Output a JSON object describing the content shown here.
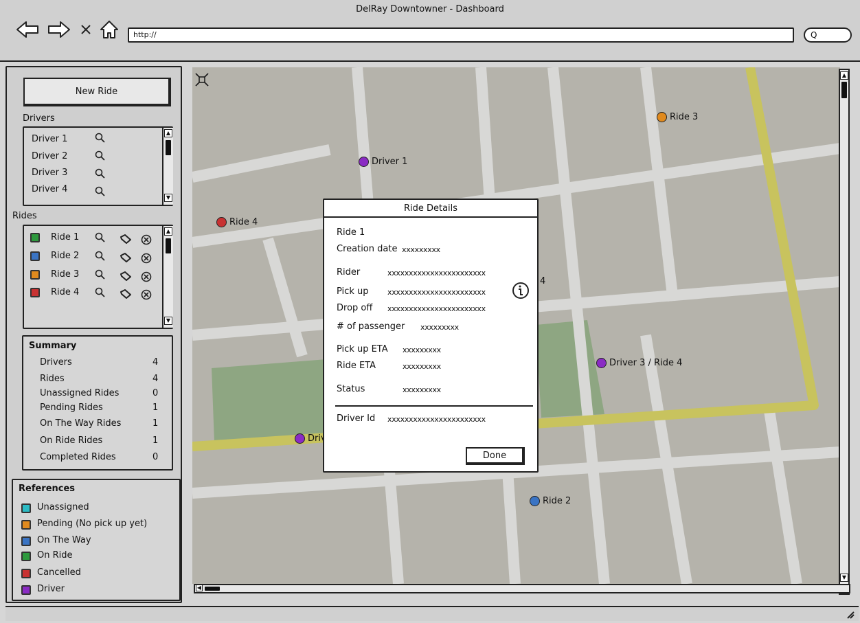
{
  "window": {
    "title": "DelRay Downtowner - Dashboard",
    "url": "http://",
    "search_label": "Q"
  },
  "sidebar": {
    "new_ride_label": "New Ride",
    "drivers_title": "Drivers",
    "drivers": [
      {
        "label": "Driver 1"
      },
      {
        "label": "Driver 2"
      },
      {
        "label": "Driver 3"
      },
      {
        "label": "Driver 4"
      }
    ],
    "rides_title": "Rides",
    "rides": [
      {
        "label": "Ride 1",
        "color": "#2e9a3e"
      },
      {
        "label": "Ride 2",
        "color": "#3a74c4"
      },
      {
        "label": "Ride 3",
        "color": "#e08a1e"
      },
      {
        "label": "Ride 4",
        "color": "#c83232"
      }
    ],
    "summary": {
      "title": "Summary",
      "rows": [
        {
          "label": "Drivers",
          "value": "4"
        },
        {
          "label": "Rides",
          "value": "4"
        },
        {
          "label": "Unassigned Rides",
          "value": "0"
        },
        {
          "label": "Pending Rides",
          "value": "1"
        },
        {
          "label": "On The Way Rides",
          "value": "1"
        },
        {
          "label": "On Ride Rides",
          "value": "1"
        },
        {
          "label": "Completed Rides",
          "value": "0"
        }
      ]
    },
    "references": {
      "title": "References",
      "items": [
        {
          "label": "Unassigned",
          "color": "#2bbbc4"
        },
        {
          "label": "Pending (No pick up yet)",
          "color": "#e08a1e"
        },
        {
          "label": "On The Way",
          "color": "#3a74c4"
        },
        {
          "label": "On Ride",
          "color": "#2e9a3e"
        },
        {
          "label": "Cancelled",
          "color": "#c83232"
        },
        {
          "label": "Driver",
          "color": "#8a2bc4"
        }
      ]
    }
  },
  "map": {
    "markers": [
      {
        "label": "Ride 3",
        "color": "#e08a1e"
      },
      {
        "label": "Driver 1",
        "color": "#8a2bc4"
      },
      {
        "label": "Ride 4",
        "color": "#c83232"
      },
      {
        "label": "Driver 3 / Ride 4",
        "color": "#8a2bc4"
      },
      {
        "label": "Driv",
        "color": "#8a2bc4"
      },
      {
        "label": "Ride 2",
        "color": "#3a74c4"
      }
    ],
    "hidden_fragment": "4"
  },
  "modal": {
    "title": "Ride Details",
    "ride_name": "Ride 1",
    "creation_label": "Creation date",
    "creation_value": "xxxxxxxxx",
    "rider_label": "Rider",
    "rider_value": "xxxxxxxxxxxxxxxxxxxxxxx",
    "pickup_label": "Pick up",
    "pickup_value": "xxxxxxxxxxxxxxxxxxxxxxx",
    "dropoff_label": "Drop off",
    "dropoff_value": "xxxxxxxxxxxxxxxxxxxxxxx",
    "passenger_label": "# of passenger",
    "passenger_value": "xxxxxxxxx",
    "pickup_eta_label": "Pick up ETA",
    "pickup_eta_value": "xxxxxxxxx",
    "ride_eta_label": "Ride ETA",
    "ride_eta_value": "xxxxxxxxx",
    "status_label": "Status",
    "status_value": "xxxxxxxxx",
    "driver_id_label": "Driver Id",
    "driver_id_value": "xxxxxxxxxxxxxxxxxxxxxxx",
    "done_label": "Done"
  }
}
